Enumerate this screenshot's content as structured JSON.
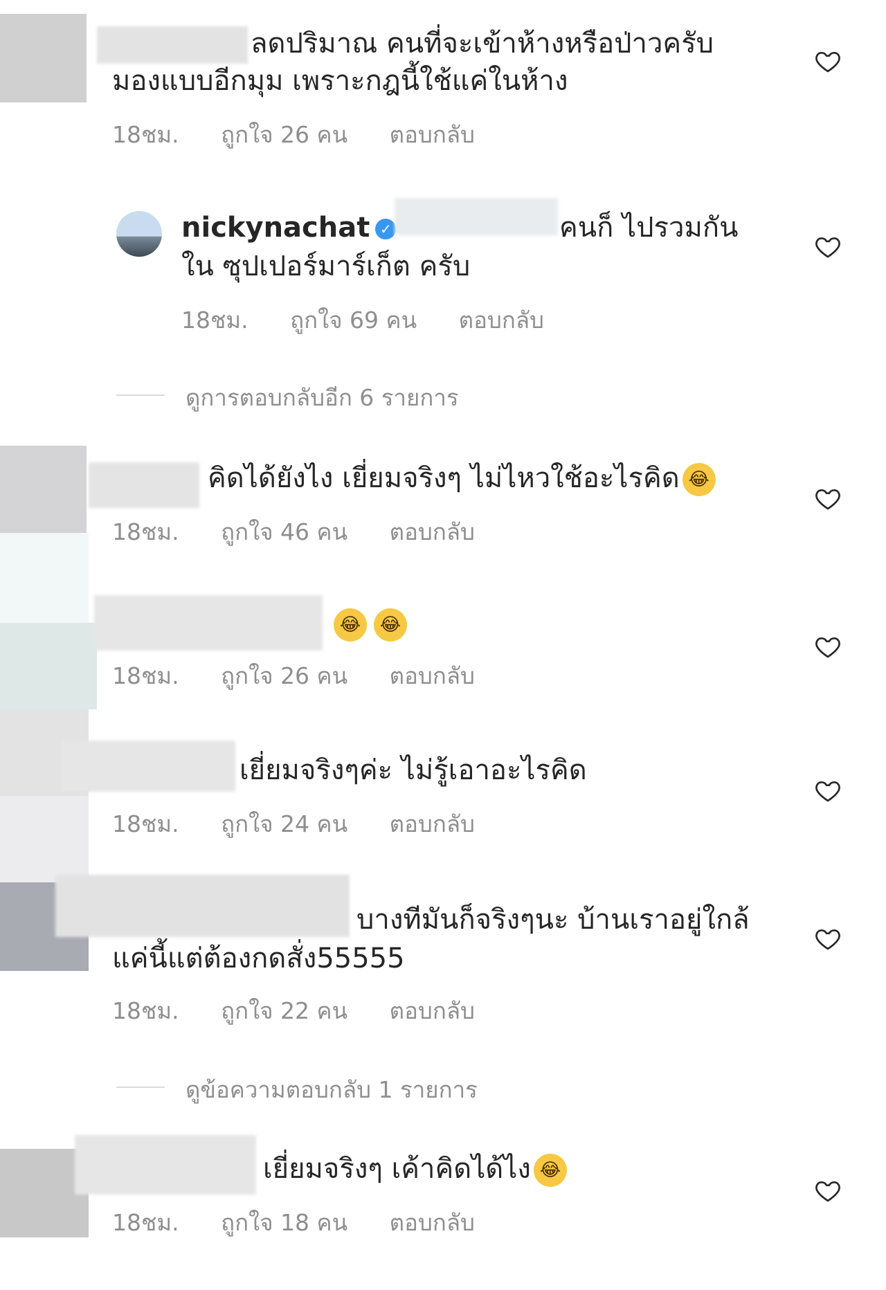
{
  "comments": [
    {
      "line1": "ลดปริมาณ คนที่จะเข้าห้างหรือป่าวครับ",
      "line2": "มองแบบอีกมุม เพราะกฎนี้ใช้แค่ในห้าง",
      "time": "18ชม.",
      "likes": "ถูกใจ 26 คน",
      "reply": "ตอบกลับ"
    },
    {
      "username": "nickynachat",
      "line1": "คนก็ ไปรวมกัน",
      "line2": "ใน ซุปเปอร์มาร์เก็ต ครับ",
      "time": "18ชม.",
      "likes": "ถูกใจ 69 คน",
      "reply": "ตอบกลับ"
    },
    {
      "line1": "คิดได้ยังไง เยี่ยมจริงๆ ไม่ไหวใช้อะไรคิด",
      "time": "18ชม.",
      "likes": "ถูกใจ 46 คน",
      "reply": "ตอบกลับ"
    },
    {
      "line1": "",
      "time": "18ชม.",
      "likes": "ถูกใจ 26 คน",
      "reply": "ตอบกลับ"
    },
    {
      "line1": "เยี่ยมจริงๆค่ะ ไม่รู้เอาอะไรคิด",
      "time": "18ชม.",
      "likes": "ถูกใจ 24 คน",
      "reply": "ตอบกลับ"
    },
    {
      "line1": "บางทีมันก็จริงๆนะ บ้านเราอยู่ใกล้",
      "line2": "แค่นี้แต่ต้องกดสั่ง55555",
      "time": "18ชม.",
      "likes": "ถูกใจ 22 คน",
      "reply": "ตอบกลับ"
    },
    {
      "line1": "เยี่ยมจริงๆ เค้าคิดได้ไง",
      "time": "18ชม.",
      "likes": "ถูกใจ 18 คน",
      "reply": "ตอบกลับ"
    }
  ],
  "view_replies": [
    "ดูการตอบกลับอีก 6 รายการ",
    "ดูข้อความตอบกลับ 1 รายการ"
  ],
  "icons": {
    "like": "heart-outline-icon",
    "verified": "verified-badge-icon",
    "emoji": "laughing-tears-emoji"
  },
  "colors": {
    "text": "#262626",
    "meta": "#8e8e8e",
    "verified": "#3897f0"
  }
}
